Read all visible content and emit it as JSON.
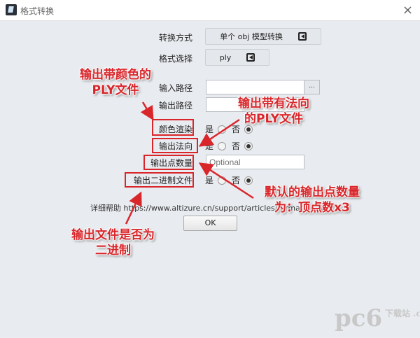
{
  "window": {
    "title": "格式转换",
    "close_icon": "×"
  },
  "form": {
    "conversion_mode": {
      "label": "转换方式",
      "value": "单个 obj 模型转换"
    },
    "format": {
      "label": "格式选择",
      "value": "ply"
    },
    "input_path": {
      "label": "输入路径",
      "value": "",
      "browse": "..."
    },
    "output_path": {
      "label": "输出路径",
      "value": ""
    },
    "color_render": {
      "label": "颜色渲染",
      "yes": "是",
      "no": "否",
      "selected": "否"
    },
    "output_normals": {
      "label": "输出法向",
      "yes": "是",
      "no": "否",
      "selected": "否"
    },
    "point_count": {
      "label": "输出点数量",
      "placeholder": "Optional"
    },
    "binary": {
      "label": "输出二进制文件",
      "yes": "是",
      "no": "否",
      "selected": "否"
    },
    "help_label": "详细帮助",
    "help_url": "https://www.altizure.cn/support/articles/format-conv...",
    "ok": "OK"
  },
  "annotations": {
    "color": [
      "输出带颜色的",
      "PLY文件"
    ],
    "normals": [
      "输出带有法向",
      "的PLY文件"
    ],
    "points": [
      "默认的输出点数量",
      "为：顶点数x3"
    ],
    "binary": [
      "输出文件是否为",
      "二进制"
    ]
  },
  "watermark": {
    "brand": "pc6",
    "sub": "下载站 .com"
  },
  "colors": {
    "annotation": "#d9262b",
    "background": "#e8ebef"
  }
}
